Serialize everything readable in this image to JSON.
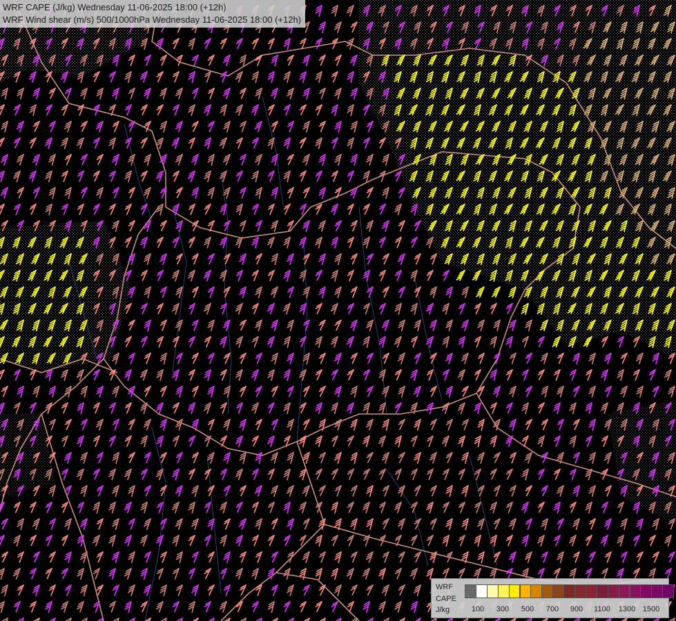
{
  "header": {
    "line1": "WRF CAPE (J/kg) Wednesday 11-06-2025 18:00 (+12h)",
    "line2": "WRF Wind shear (m/s) 500/1000hPa Wednesday 11-06-2025 18:00 (+12h)"
  },
  "legend": {
    "model": "WRF",
    "variable": "CAPE",
    "unit": "J/kg",
    "colors": [
      "#6a6a6a",
      "#ffffff",
      "#fff8b0",
      "#fff35a",
      "#ffeb00",
      "#ffb300",
      "#d98500",
      "#a35a12",
      "#8c4418",
      "#7a2a22",
      "#84282c",
      "#8c2232",
      "#7c1e3a",
      "#8a1a48",
      "#901657",
      "#8a1060",
      "#800a62",
      "#7a0866",
      "#700468"
    ],
    "ticks": [
      "100",
      "300",
      "500",
      "700",
      "900",
      "1100",
      "1300",
      "1500"
    ]
  },
  "map_colors": {
    "background": "#000000",
    "borders": "#f0a890",
    "rivers": "#3a5a9a",
    "shear_magenta": "#e030ff",
    "shear_salmon": "#ff8a80",
    "shear_rose": "#d08078",
    "shear_yellow": "#ffff00",
    "shear_tan": "#d8b070",
    "cape_stipple": "#c0c0c0"
  }
}
